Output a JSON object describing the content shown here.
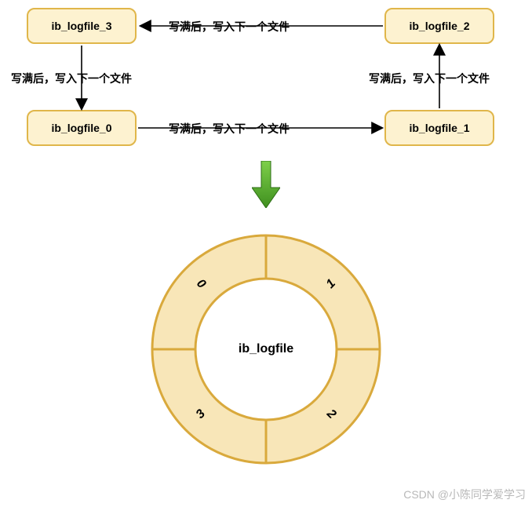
{
  "chart_data": {
    "type": "pie",
    "title": "ib_logfile",
    "categories": [
      "0",
      "1",
      "2",
      "3"
    ],
    "values": [
      1,
      1,
      1,
      1
    ]
  },
  "nodes": {
    "top_left": {
      "label": "ib_logfile_3"
    },
    "top_right": {
      "label": "ib_logfile_2"
    },
    "bot_left": {
      "label": "ib_logfile_0"
    },
    "bot_right": {
      "label": "ib_logfile_1"
    }
  },
  "edges": {
    "top": {
      "label": "写满后，写入下一个文件"
    },
    "right": {
      "label": "写满后，写入下一个文件"
    },
    "bottom": {
      "label": "写满后，写入下一个文件"
    },
    "left": {
      "label": "写满后，写入下一个文件"
    }
  },
  "donut": {
    "center_label": "ib_logfile",
    "segments": [
      "0",
      "1",
      "2",
      "3"
    ]
  },
  "watermark": "CSDN @小陈同学爱学习",
  "colors": {
    "node_fill": "#fdf2d0",
    "node_border": "#e0b64a",
    "donut_fill": "#f8e6b8",
    "donut_border": "#d9a93c",
    "arrow_green_light": "#6fbf3a",
    "arrow_green_dark": "#3f8f1f"
  }
}
